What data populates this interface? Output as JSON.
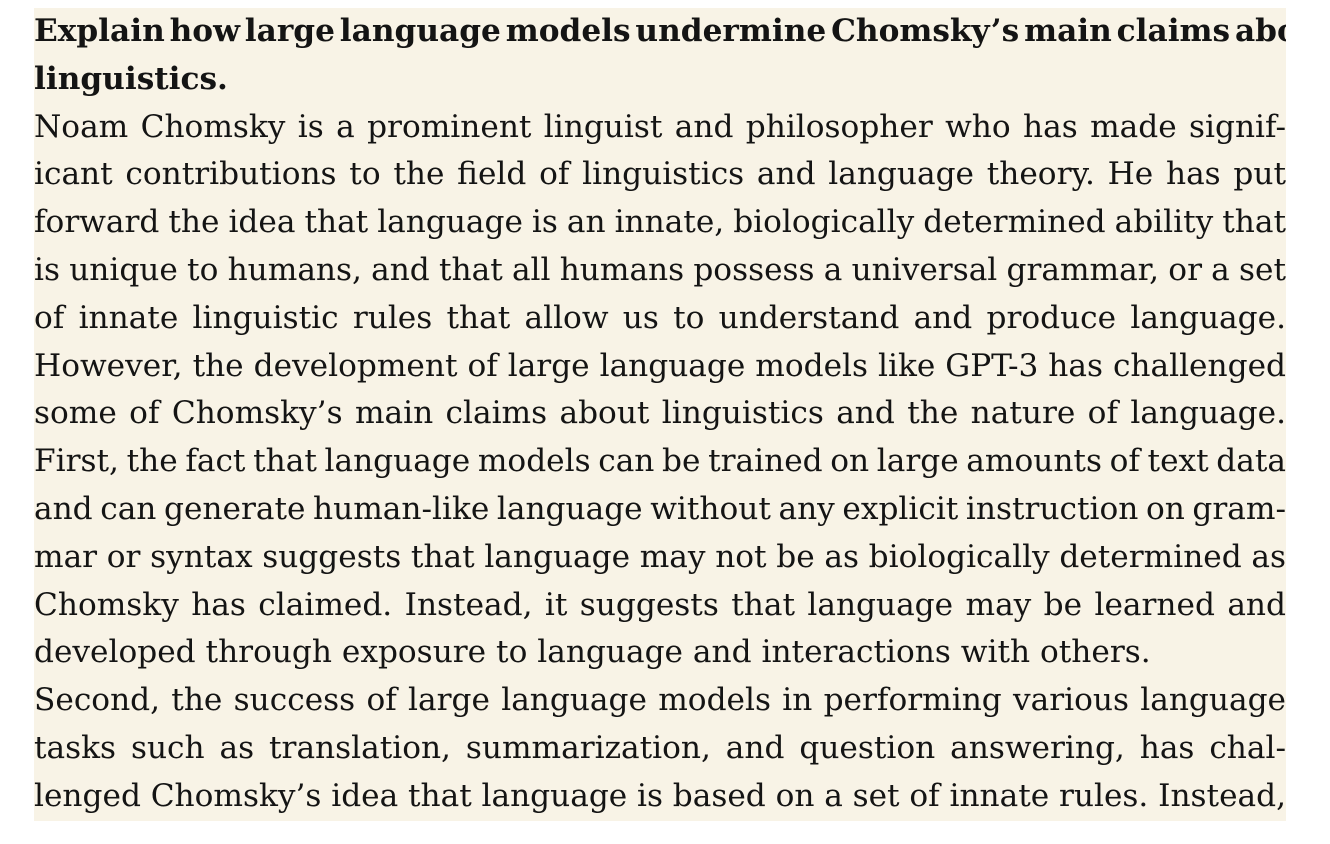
{
  "document": {
    "prompt_lines": [
      "Explain how large language models undermine Chomsky’s main claims about",
      "linguistics."
    ],
    "body_lines": [
      "Noam Chomsky is a prominent linguist and philosopher who has made signif-",
      "icant contributions to the field of linguistics and language theory. He has put",
      "forward the idea that language is an innate, biologically determined ability that",
      "is unique to humans, and that all humans possess a universal grammar, or a set",
      "of innate linguistic rules that allow us to understand and produce language.",
      "However, the development of large language models like GPT-3 has challenged",
      "some of Chomsky’s main claims about linguistics and the nature of language.",
      "First, the fact that language models can be trained on large amounts of text data",
      "and can generate human-like language without any explicit instruction on gram-",
      "mar or syntax suggests that language may not be as biologically determined as",
      "Chomsky has claimed. Instead, it suggests that language may be learned and",
      "developed through exposure to language and interactions with others.",
      "Second, the success of large language models in performing various language",
      "tasks such as translation, summarization, and question answering, has chal-",
      "lenged Chomsky’s idea that language is based on a set of innate rules. Instead,"
    ],
    "highlight_color": "#f8f3e6",
    "text_color": "#141414"
  }
}
